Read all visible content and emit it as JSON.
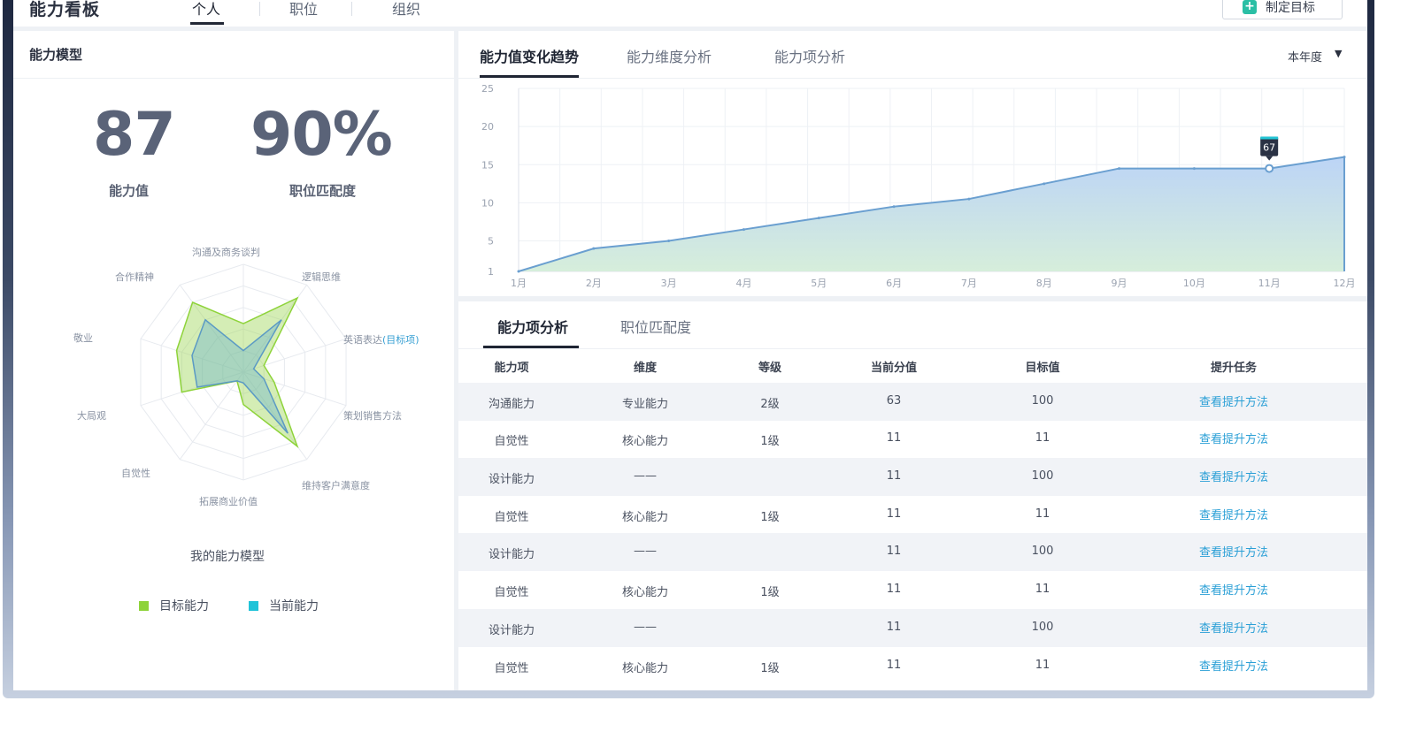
{
  "header": {
    "title": "能力看板",
    "tabs": [
      "个人",
      "职位",
      "组织"
    ],
    "goal_button": "制定目标"
  },
  "left": {
    "title": "能力模型",
    "stats": [
      {
        "value": "87",
        "label": "能力值"
      },
      {
        "value": "90%",
        "label": "职位匹配度"
      }
    ],
    "radar_labels": [
      "沟通及商务谈判",
      "逻辑思维",
      "英语表达",
      "策划销售方法",
      "维持客户满意度",
      "拓展商业价值",
      "自觉性",
      "大局观",
      "敬业",
      "合作精神"
    ],
    "radar_target_suffix": "(目标项)",
    "radar_target": [
      0.45,
      0.85,
      0.2,
      0.3,
      0.85,
      0.3,
      0.1,
      0.6,
      0.65,
      0.8
    ],
    "radar_current": [
      0.2,
      0.6,
      0.1,
      0.2,
      0.7,
      0.1,
      0.1,
      0.45,
      0.5,
      0.6
    ],
    "radar_max": 1,
    "model_title": "我的能力模型",
    "legend": [
      {
        "label": "目标能力",
        "color": "#8ed33a"
      },
      {
        "label": "当前能力",
        "color": "#20c3d8"
      }
    ]
  },
  "chart": {
    "tabs": [
      "能力值变化趋势",
      "能力维度分析",
      "能力项分析"
    ],
    "period": "本年度",
    "marker_label": "67"
  },
  "chart_data": {
    "type": "area",
    "categories": [
      "1月",
      "2月",
      "3月",
      "4月",
      "5月",
      "6月",
      "7月",
      "8月",
      "9月",
      "10月",
      "11月",
      "12月"
    ],
    "y_ticks": [
      "1",
      "5",
      "10",
      "15",
      "20",
      "25"
    ],
    "ylim": [
      1,
      25
    ],
    "series": [
      {
        "values": [
          1,
          4,
          5,
          6.5,
          8,
          9.5,
          10.5,
          12.5,
          14.5,
          14.5,
          14.5,
          16
        ]
      }
    ]
  },
  "table": {
    "tabs": [
      "能力项分析",
      "职位匹配度"
    ],
    "columns": [
      "能力项",
      "维度",
      "等级",
      "当前分值",
      "目标值",
      "提升任务"
    ],
    "rows": [
      {
        "item": "沟通能力",
        "dimension": "专业能力",
        "level": "2级",
        "current": "63",
        "target": "100",
        "task": "查看提升方法"
      },
      {
        "item": "自觉性",
        "dimension": "核心能力",
        "level": "1级",
        "current": "11",
        "target": "11",
        "task": "查看提升方法"
      },
      {
        "item": "设计能力",
        "dimension": "——",
        "level": "",
        "current": "11",
        "target": "100",
        "task": "查看提升方法"
      },
      {
        "item": "自觉性",
        "dimension": "核心能力",
        "level": "1级",
        "current": "11",
        "target": "11",
        "task": "查看提升方法"
      },
      {
        "item": "设计能力",
        "dimension": "——",
        "level": "",
        "current": "11",
        "target": "100",
        "task": "查看提升方法"
      },
      {
        "item": "自觉性",
        "dimension": "核心能力",
        "level": "1级",
        "current": "11",
        "target": "11",
        "task": "查看提升方法"
      },
      {
        "item": "设计能力",
        "dimension": "——",
        "level": "",
        "current": "11",
        "target": "100",
        "task": "查看提升方法"
      },
      {
        "item": "自觉性",
        "dimension": "核心能力",
        "level": "1级",
        "current": "11",
        "target": "11",
        "task": "查看提升方法"
      }
    ]
  }
}
